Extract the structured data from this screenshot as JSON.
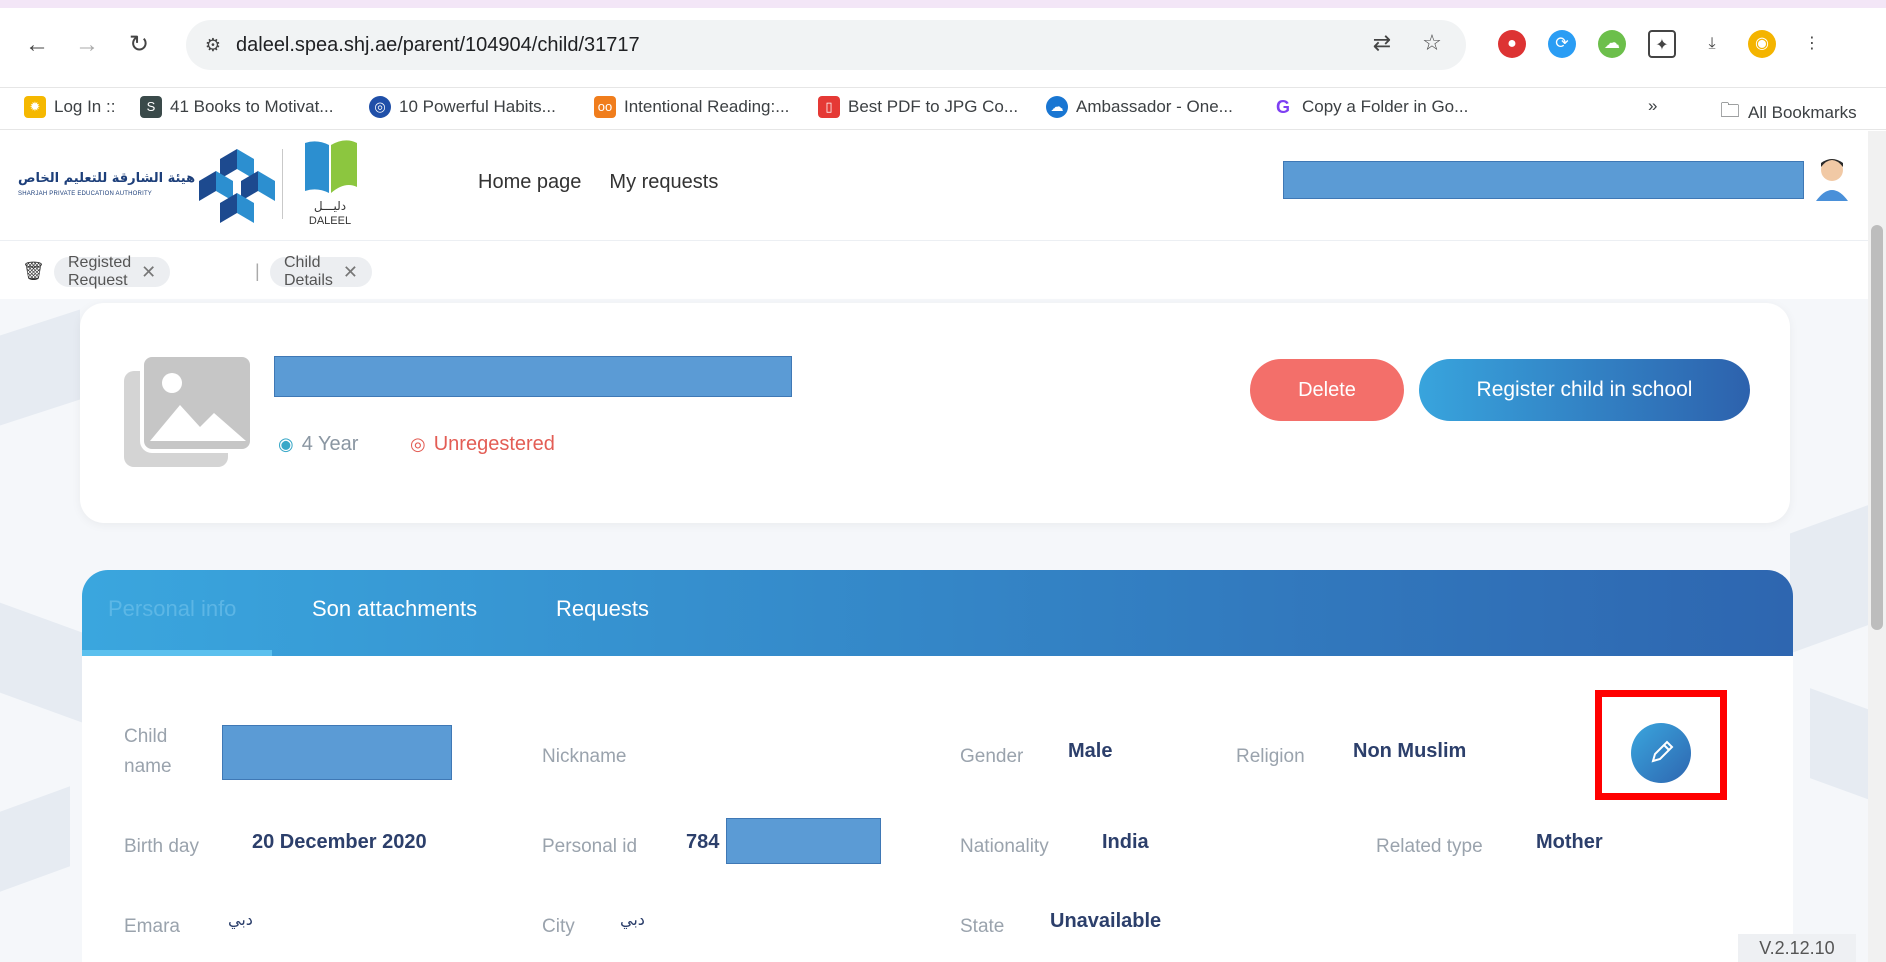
{
  "browser": {
    "url": "daleel.spea.shj.ae/parent/104904/child/31717",
    "bookmarks": [
      "Log In ::",
      "41 Books to Motivat...",
      "10 Powerful Habits...",
      "Intentional Reading:...",
      "Best PDF to JPG Co...",
      "Ambassador - One...",
      "Copy a Folder in Go..."
    ],
    "more_bookmarks": "»",
    "all_bookmarks": "All Bookmarks"
  },
  "header": {
    "org_name_ar": "هيئة الشارقة للتعليم الخاص",
    "org_name_en": "SHARJAH PRIVATE EDUCATION AUTHORITY",
    "daleel_ar": "دليـــل",
    "daleel_en": "DALEEL",
    "nav": [
      "Home page",
      "My requests"
    ]
  },
  "breadcrumbs": {
    "items": [
      "Registed Request",
      "Child Details"
    ],
    "close": "✕",
    "separator": "|"
  },
  "child_card": {
    "age": "4 Year",
    "status": "Unregestered",
    "delete_label": "Delete",
    "register_label": "Register child in school"
  },
  "tabs": [
    "Personal info",
    "Son attachments",
    "Requests"
  ],
  "personal_info": {
    "child_name_label": "Child",
    "child_name_label2": "name",
    "nickname_label": "Nickname",
    "gender_label": "Gender",
    "gender_value": "Male",
    "religion_label": "Religion",
    "religion_value": "Non Muslim",
    "birthday_label": "Birth day",
    "birthday_value": "20 December 2020",
    "personal_id_label": "Personal id",
    "personal_id_prefix": "784",
    "nationality_label": "Nationality",
    "nationality_value": "India",
    "related_type_label": "Related type",
    "related_type_value": "Mother",
    "emara_label": "Emara",
    "emara_value": "دبي",
    "city_label": "City",
    "city_value": "دبي",
    "state_label": "State",
    "state_value": "Unavailable"
  },
  "version": "V.2.12.10",
  "colors": {
    "accent_start": "#3aa6de",
    "accent_end": "#2e66b0",
    "delete": "#f36f6a",
    "status_unregistered": "#e35d55",
    "age": "#39a8c8",
    "highlight": "#ff0000"
  }
}
